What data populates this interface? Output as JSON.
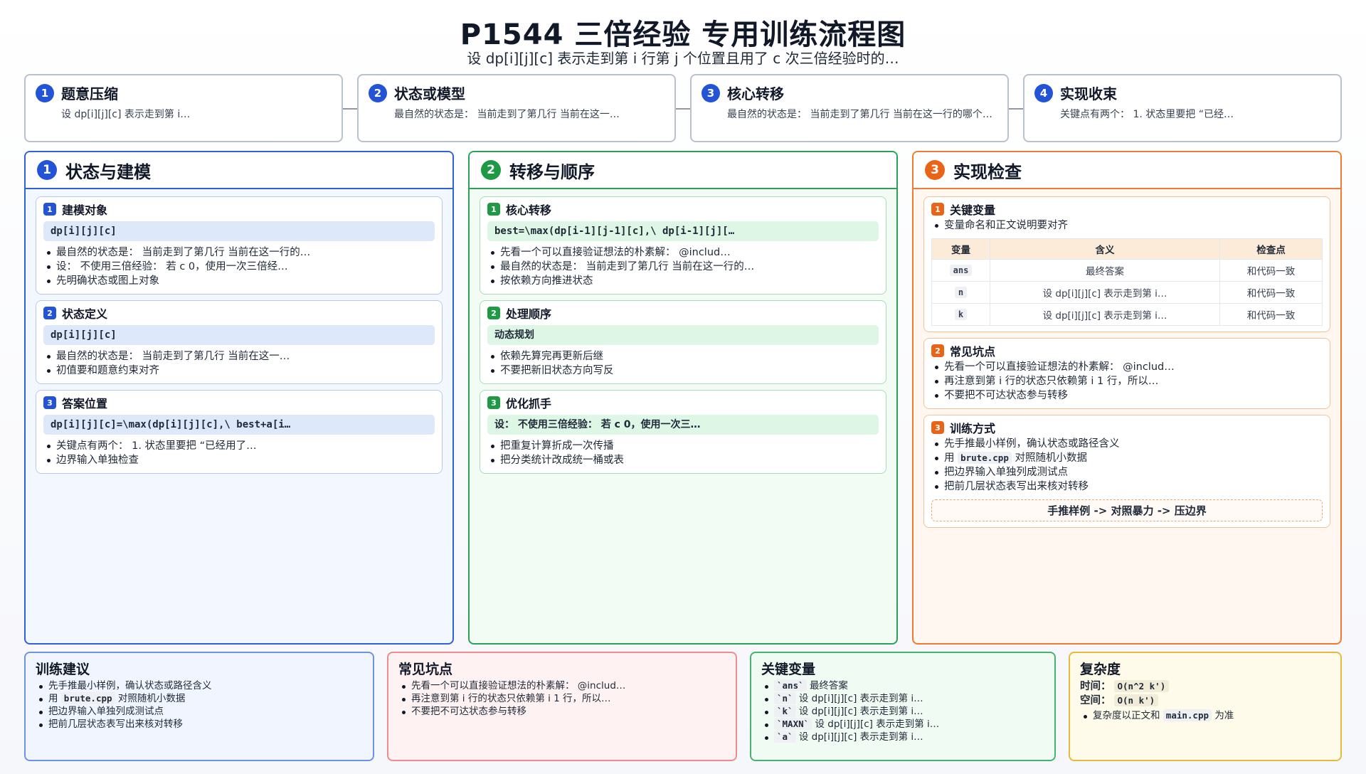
{
  "header": {
    "title": "P1544 三倍经验 专用训练流程图",
    "subtitle": "设 dp[i][j][c] 表示走到第 i 行第 j 个位置且用了 c 次三倍经验时的…"
  },
  "steps": [
    {
      "num": "1",
      "title": "题意压缩",
      "desc": "设 dp[i][j][c] 表示走到第 i…"
    },
    {
      "num": "2",
      "title": "状态或模型",
      "desc": "最自然的状态是： 当前走到了第几行 当前在这一…"
    },
    {
      "num": "3",
      "title": "核心转移",
      "desc": "最自然的状态是： 当前走到了第几行 当前在这一行的哪个…"
    },
    {
      "num": "4",
      "title": "实现收束",
      "desc": "关键点有两个： 1. 状态里要把 “已经…"
    }
  ],
  "columns": {
    "state": {
      "num": "1",
      "title": "状态与建模",
      "cards": [
        {
          "num": "1",
          "title": "建模对象",
          "code": "dp[i][j][c]",
          "bullets": [
            "最自然的状态是： 当前走到了第几行 当前在这一行的…",
            "设： 不使用三倍经验： 若 c 0，使用一次三倍经…",
            "先明确状态或图上对象"
          ]
        },
        {
          "num": "2",
          "title": "状态定义",
          "code": "dp[i][j][c]",
          "bullets": [
            "最自然的状态是： 当前走到了第几行 当前在这一…",
            "初值要和题意约束对齐"
          ]
        },
        {
          "num": "3",
          "title": "答案位置",
          "code": "dp[i][j][c]=\\max(dp[i][j][c],\\ best+a[i…",
          "bullets": [
            "关键点有两个： 1. 状态里要把 “已经用了…",
            "边界输入单独检查"
          ]
        }
      ]
    },
    "transition": {
      "num": "2",
      "title": "转移与顺序",
      "cards": [
        {
          "num": "1",
          "title": "核心转移",
          "code": "best=\\max(dp[i-1][j-1][c],\\ dp[i-1][j][…",
          "bullets": [
            "先看一个可以直接验证想法的朴素解： @includ…",
            "最自然的状态是： 当前走到了第几行 当前在这一行的…",
            "按依赖方向推进状态"
          ]
        },
        {
          "num": "2",
          "title": "处理顺序",
          "code": "动态规划",
          "bullets": [
            "依赖先算完再更新后继",
            "不要把新旧状态方向写反"
          ]
        },
        {
          "num": "3",
          "title": "优化抓手",
          "code": "设： 不使用三倍经验： 若 c 0，使用一次三…",
          "bullets": [
            "把重复计算折成一次传播",
            "把分类统计改成统一桶或表"
          ]
        }
      ]
    },
    "impl": {
      "num": "3",
      "title": "实现检查",
      "vars_card": {
        "num": "1",
        "title": "关键变量",
        "bullet": "变量命名和正文说明要对齐",
        "headers": [
          "变量",
          "含义",
          "检查点"
        ],
        "rows": [
          {
            "var": "ans",
            "meaning": "最终答案",
            "check": "和代码一致"
          },
          {
            "var": "n",
            "meaning": "设 dp[i][j][c] 表示走到第 i…",
            "check": "和代码一致"
          },
          {
            "var": "k",
            "meaning": "设 dp[i][j][c] 表示走到第 i…",
            "check": "和代码一致"
          }
        ]
      },
      "pitfalls_card": {
        "num": "2",
        "title": "常见坑点",
        "bullets": [
          "先看一个可以直接验证想法的朴素解： @includ…",
          "再注意到第 i 行的状态只依赖第 i 1 行，所以…",
          "不要把不可达状态参与转移"
        ]
      },
      "train_card": {
        "num": "3",
        "title": "训练方式",
        "b1": "先手推最小样例，确认状态或路径含义",
        "b2_pre": "用",
        "b2_code": "brute.cpp",
        "b2_post": "对照随机小数据",
        "b3": "把边界输入单独列成测试点",
        "b4": "把前几层状态表写出来核对转移",
        "pipeline": "手推样例 -> 对照暴力 -> 压边界"
      }
    }
  },
  "bottom": {
    "advice": {
      "title": "训练建议",
      "b1": "先手推最小样例，确认状态或路径含义",
      "b2_pre": "用",
      "b2_code": "brute.cpp",
      "b2_post": "对照随机小数据",
      "b3": "把边界输入单独列成测试点",
      "b4": "把前几层状态表写出来核对转移"
    },
    "pitfalls": {
      "title": "常见坑点",
      "bullets": [
        "先看一个可以直接验证想法的朴素解： @includ…",
        "再注意到第 i 行的状态只依赖第 i 1 行，所以…",
        "不要把不可达状态参与转移"
      ]
    },
    "vars": {
      "title": "关键变量",
      "items": [
        {
          "code": "`ans`",
          "text": "最终答案"
        },
        {
          "code": "`n`",
          "text": "设 dp[i][j][c] 表示走到第 i…"
        },
        {
          "code": "`k`",
          "text": "设 dp[i][j][c] 表示走到第 i…"
        },
        {
          "code": "`MAXN`",
          "text": "设 dp[i][j][c] 表示走到第 i…"
        },
        {
          "code": "`a`",
          "text": "设 dp[i][j][c] 表示走到第 i…"
        }
      ]
    },
    "complexity": {
      "title": "复杂度",
      "time_label": "时间：",
      "time_value": "O(n^2 k')",
      "space_label": "空间：",
      "space_value": "O(n k')",
      "note_pre": "复杂度以正文和",
      "note_code": "main.cpp",
      "note_post": "为准"
    }
  },
  "colors": {
    "blue": "#2454d6",
    "green": "#1e9a45",
    "orange": "#ea6417"
  }
}
